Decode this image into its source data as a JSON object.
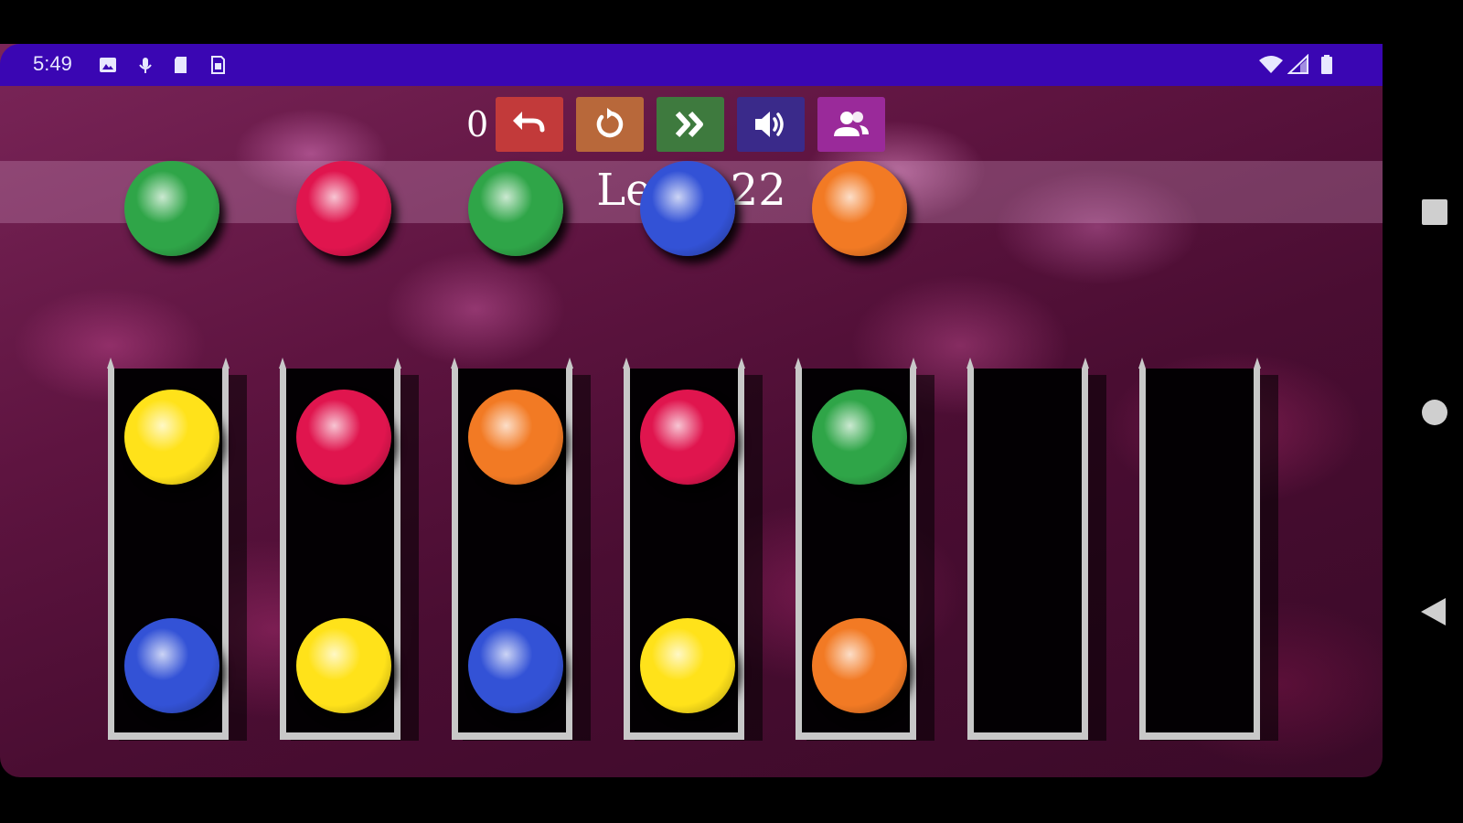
{
  "status_bar": {
    "time": "5:49",
    "left_icons": [
      "photo-icon",
      "mic-icon",
      "sd-card-icon",
      "sim-icon"
    ],
    "right_icons": [
      "wifi-icon",
      "signal-icon",
      "battery-icon"
    ],
    "background": "#3a06b3"
  },
  "toolbar": {
    "move_count": "0",
    "buttons": [
      {
        "name": "undo",
        "icon": "undo-icon",
        "color": "#c23a3a"
      },
      {
        "name": "restart",
        "icon": "restart-icon",
        "color": "#b8683a"
      },
      {
        "name": "skip",
        "icon": "fast-forward-icon",
        "color": "#3e7a3e"
      },
      {
        "name": "sound",
        "icon": "speaker-icon",
        "color": "#3a2a8a"
      },
      {
        "name": "players",
        "icon": "people-icon",
        "color": "#9a2a9a"
      }
    ]
  },
  "level": {
    "title": "Level 22"
  },
  "colors": {
    "green": "#2fa548",
    "red": "#e0154e",
    "yellow": "#ffe21a",
    "blue": "#3352d6",
    "orange": "#f27a24"
  },
  "tubes": [
    {
      "balls": [
        "green",
        "yellow",
        "blue"
      ]
    },
    {
      "balls": [
        "red",
        "red",
        "yellow"
      ]
    },
    {
      "balls": [
        "green",
        "orange",
        "blue"
      ]
    },
    {
      "balls": [
        "blue",
        "red",
        "yellow"
      ]
    },
    {
      "balls": [
        "orange",
        "green",
        "orange"
      ]
    },
    {
      "balls": []
    },
    {
      "balls": []
    }
  ],
  "nav_bar": {
    "buttons": [
      "recents-icon",
      "home-icon",
      "back-icon"
    ]
  }
}
